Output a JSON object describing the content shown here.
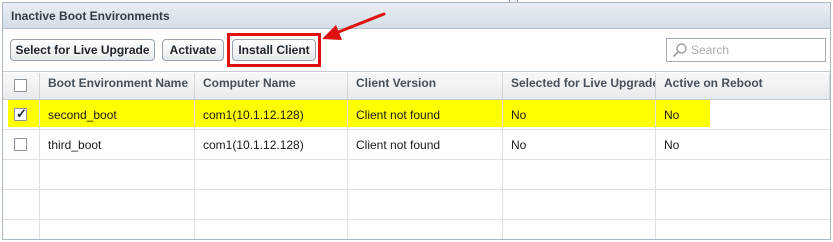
{
  "panel": {
    "title": "Inactive Boot Environments"
  },
  "toolbar": {
    "select_label": "Select for Live Upgrade",
    "activate_label": "Activate",
    "install_label": "Install Client"
  },
  "search": {
    "placeholder": "Search",
    "value": ""
  },
  "table": {
    "columns": [
      "Boot Environment Name",
      "Computer Name",
      "Client Version",
      "Selected for Live Upgrade",
      "Active on Reboot"
    ],
    "rows": [
      {
        "checked": true,
        "cells": [
          "second_boot",
          "com1(10.1.12.128)",
          "Client not found",
          "No",
          "No"
        ]
      },
      {
        "checked": false,
        "cells": [
          "third_boot",
          "com1(10.1.12.128)",
          "Client not found",
          "No",
          "No"
        ]
      }
    ]
  },
  "colors": {
    "highlight": "#ffff00",
    "annotation": "#e01010"
  },
  "icons": [
    "search-icon",
    "checkbox-icon",
    "annotation-arrow-icon"
  ]
}
